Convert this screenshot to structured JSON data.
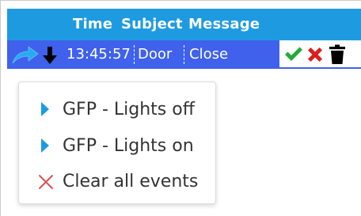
{
  "table": {
    "columns": [
      "Time",
      "Subject",
      "Message"
    ],
    "rows": [
      {
        "time": "13:45:57",
        "subject": "Door",
        "message": "Close"
      }
    ],
    "row_icons": [
      "share-arrow-icon",
      "down-arrow-icon"
    ],
    "row_actions": [
      "check-icon",
      "cross-icon",
      "trash-icon"
    ]
  },
  "context_menu": {
    "items": [
      {
        "label": "GFP - Lights off",
        "icon": "play-triangle-icon"
      },
      {
        "label": "GFP - Lights on",
        "icon": "play-triangle-icon"
      },
      {
        "label": "Clear all events",
        "icon": "close-x-icon"
      }
    ]
  },
  "colors": {
    "header": "#1e9be0",
    "selected_row": "#3f61ec",
    "check": "#22aa3a",
    "cross": "#e01c1c",
    "menu_triangle": "#1e9be0",
    "menu_x": "#d9534f"
  }
}
